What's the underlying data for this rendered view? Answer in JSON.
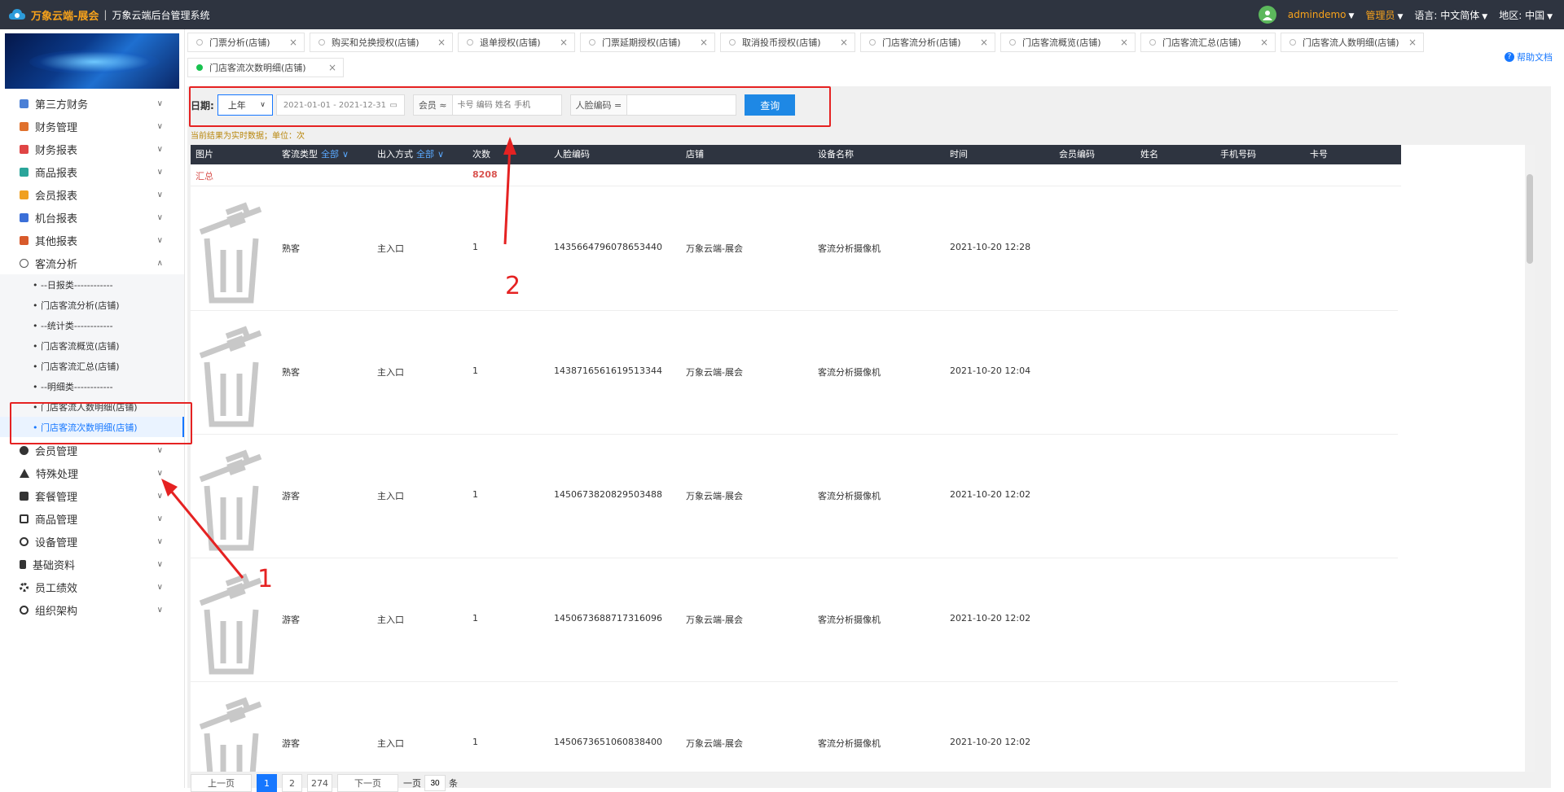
{
  "header": {
    "app_title": "万象云端-展会",
    "separator": "|",
    "app_subtitle": "万象云端后台管理系统",
    "user": "admindemo",
    "role": "管理员",
    "language_label": "语言:",
    "language_value": "中文简体",
    "region_label": "地区:",
    "region_value": "中国"
  },
  "sidebar": {
    "menu": [
      {
        "label": "第三方财务",
        "icon_color": "#4a7fd6"
      },
      {
        "label": "财务管理",
        "icon_color": "#e0712d"
      },
      {
        "label": "财务报表",
        "icon_color": "#e04545"
      },
      {
        "label": "商品报表",
        "icon_color": "#2aa59a"
      },
      {
        "label": "会员报表",
        "icon_color": "#f0a020"
      },
      {
        "label": "机台报表",
        "icon_color": "#3b6fd8"
      },
      {
        "label": "其他报表",
        "icon_color": "#d85a2b"
      },
      {
        "label": "客流分析",
        "icon_color": "#555555"
      }
    ],
    "submenu": [
      "• --日报类------------",
      "• 门店客流分析(店铺)",
      "• --统计类------------",
      "• 门店客流概览(店铺)",
      "• 门店客流汇总(店铺)",
      "• --明细类------------",
      "• 门店客流人数明细(店铺)",
      "• 门店客流次数明细(店铺)"
    ],
    "menu2": [
      {
        "label": "会员管理",
        "icon_color": "#333333"
      },
      {
        "label": "特殊处理",
        "icon_color": "#333333"
      },
      {
        "label": "套餐管理",
        "icon_color": "#333333"
      },
      {
        "label": "商品管理",
        "icon_color": "#333333"
      },
      {
        "label": "设备管理",
        "icon_color": "#333333"
      },
      {
        "label": "基础资料",
        "icon_color": "#333333"
      },
      {
        "label": "员工绩效",
        "icon_color": "#333333"
      },
      {
        "label": "组织架构",
        "icon_color": "#333333"
      }
    ]
  },
  "tabs": [
    "门票分析(店铺)",
    "购买和兑换授权(店铺)",
    "退单授权(店铺)",
    "门票延期授权(店铺)",
    "取消投币授权(店铺)",
    "门店客流分析(店铺)",
    "门店客流概览(店铺)",
    "门店客流汇总(店铺)",
    "门店客流人数明细(店铺)",
    "门店客流次数明细(店铺)"
  ],
  "help": "帮助文档",
  "filter": {
    "date_label": "日期:",
    "period": "上年",
    "range": "2021-01-01 - 2021-12-31",
    "member_label": "会员 ≈",
    "member_placeholder": "卡号 编码 姓名 手机",
    "face_label": "人脸编码 =",
    "query_button": "查询"
  },
  "note": "当前结果为实时数据；单位：次",
  "table": {
    "headers": [
      "图片",
      "客流类型",
      "出入方式",
      "次数",
      "人脸编码",
      "店铺",
      "设备名称",
      "时间",
      "会员编码",
      "姓名",
      "手机号码",
      "卡号"
    ],
    "filter_all": "全部",
    "summary_label": "汇总",
    "summary_count": "8208",
    "rows": [
      {
        "type": "熟客",
        "entry": "主入口",
        "count": "1",
        "face": "1435664796078653440",
        "store": "万象云端-展会",
        "device": "客流分析摄像机",
        "time": "2021-10-20 12:28"
      },
      {
        "type": "熟客",
        "entry": "主入口",
        "count": "1",
        "face": "1438716561619513344",
        "store": "万象云端-展会",
        "device": "客流分析摄像机",
        "time": "2021-10-20 12:04"
      },
      {
        "type": "游客",
        "entry": "主入口",
        "count": "1",
        "face": "1450673820829503488",
        "store": "万象云端-展会",
        "device": "客流分析摄像机",
        "time": "2021-10-20 12:02"
      },
      {
        "type": "游客",
        "entry": "主入口",
        "count": "1",
        "face": "1450673688717316096",
        "store": "万象云端-展会",
        "device": "客流分析摄像机",
        "time": "2021-10-20 12:02"
      },
      {
        "type": "游客",
        "entry": "主入口",
        "count": "1",
        "face": "1450673651060838400",
        "store": "万象云端-展会",
        "device": "客流分析摄像机",
        "time": "2021-10-20 12:02"
      }
    ]
  },
  "pager": {
    "prev": "上一页",
    "pages": [
      "1",
      "2",
      "274"
    ],
    "next": "下一页",
    "per_page_label": "一页",
    "per_page": "30",
    "unit": "条"
  },
  "annotations": {
    "one": "1",
    "two": "2"
  },
  "colors": {
    "accent": "#1677ff",
    "header_bg": "#2e3440",
    "annotation": "#e52222",
    "brand": "#f7a21b"
  }
}
